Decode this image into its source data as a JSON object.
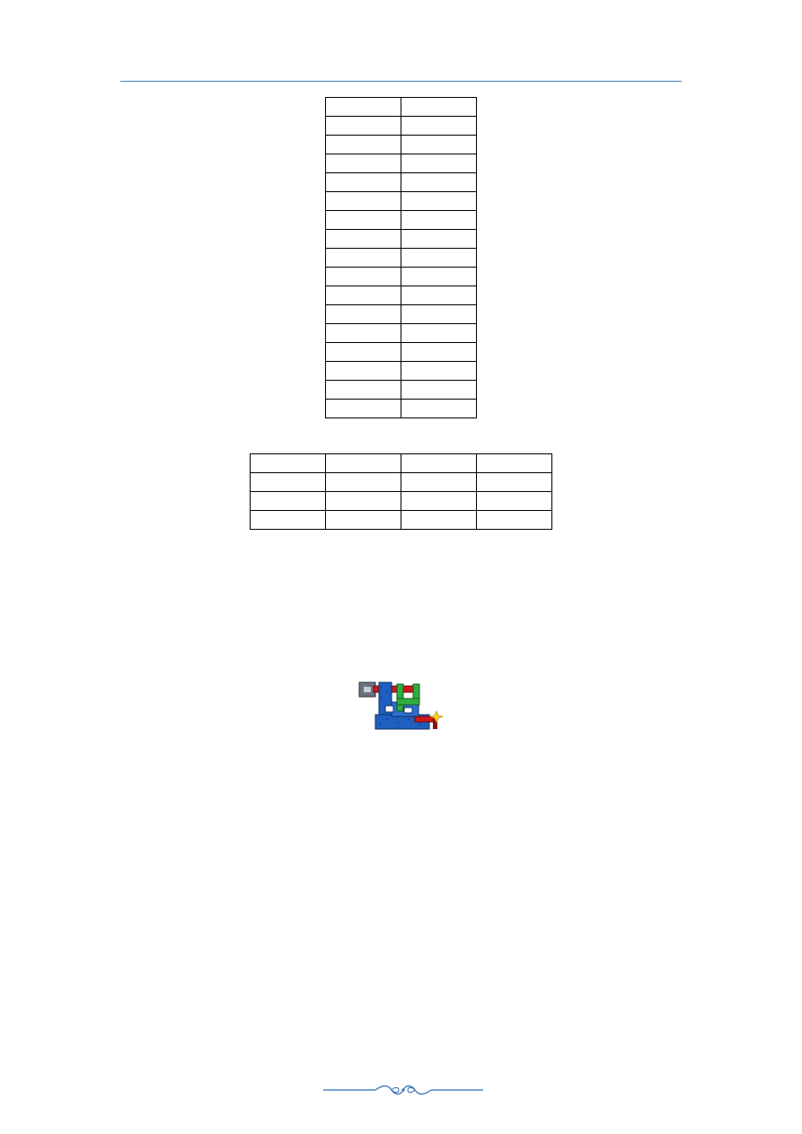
{
  "header": {
    "rule_color": "#4a7ebb"
  },
  "tables": [
    {
      "name": "table-one",
      "columns": 2,
      "rows": [
        [
          "",
          ""
        ],
        [
          "",
          ""
        ],
        [
          "",
          ""
        ],
        [
          "",
          ""
        ],
        [
          "",
          ""
        ],
        [
          "",
          ""
        ],
        [
          "",
          ""
        ],
        [
          "",
          ""
        ],
        [
          "",
          ""
        ],
        [
          "",
          ""
        ],
        [
          "",
          ""
        ],
        [
          "",
          ""
        ],
        [
          "",
          ""
        ],
        [
          "",
          ""
        ],
        [
          "",
          ""
        ],
        [
          "",
          ""
        ],
        [
          "",
          ""
        ]
      ]
    },
    {
      "name": "table-two",
      "columns": 4,
      "rows": [
        [
          "",
          "",
          "",
          ""
        ],
        [
          "",
          "",
          "",
          ""
        ],
        [
          "",
          "",
          "",
          ""
        ],
        [
          "",
          "",
          "",
          ""
        ]
      ]
    }
  ],
  "icon": {
    "name": "pipe-network-app-icon",
    "colors": {
      "blue": "#1f5fbf",
      "green": "#2fae3f",
      "red": "#d01818",
      "gray": "#6b7280",
      "spark": "#ffd21f"
    }
  },
  "footer": {
    "ornament_color": "#2f6fb7"
  }
}
